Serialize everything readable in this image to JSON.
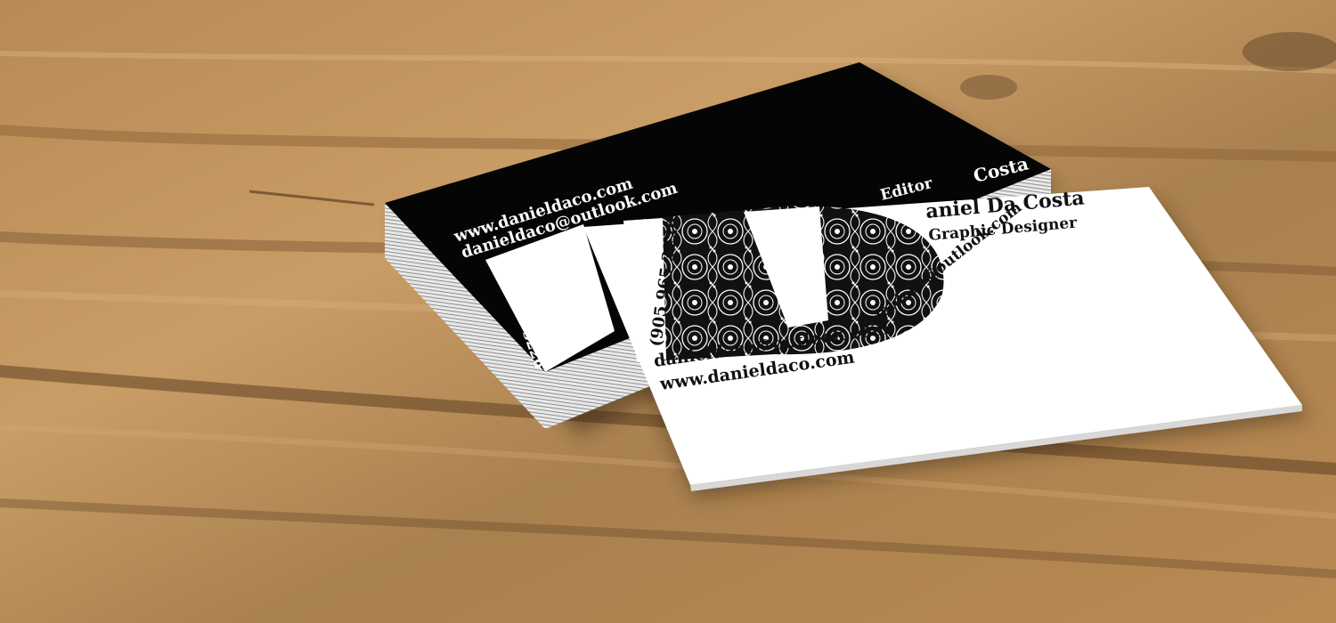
{
  "scene": {
    "surface": "wooden-table",
    "colors": {
      "wood_light": "#c89a62",
      "wood_mid": "#a57a4a",
      "wood_dark": "#6e4d2c",
      "card_black": "#050505",
      "card_white": "#ffffff",
      "stack_edge": "#d9d9d9"
    }
  },
  "back_card": {
    "website": "www.danieldaco.com",
    "email": "danieldaco@outlook.com",
    "phone": "905 965 3226",
    "title": "Editor",
    "name": "Costa"
  },
  "front_card": {
    "name": "aniel Da Costa",
    "role": "Graphic Designer",
    "phone": "(905 965 3226",
    "email": "danieldaco@outlook.com",
    "website": "www.danieldaco.com",
    "monogram": "D"
  }
}
